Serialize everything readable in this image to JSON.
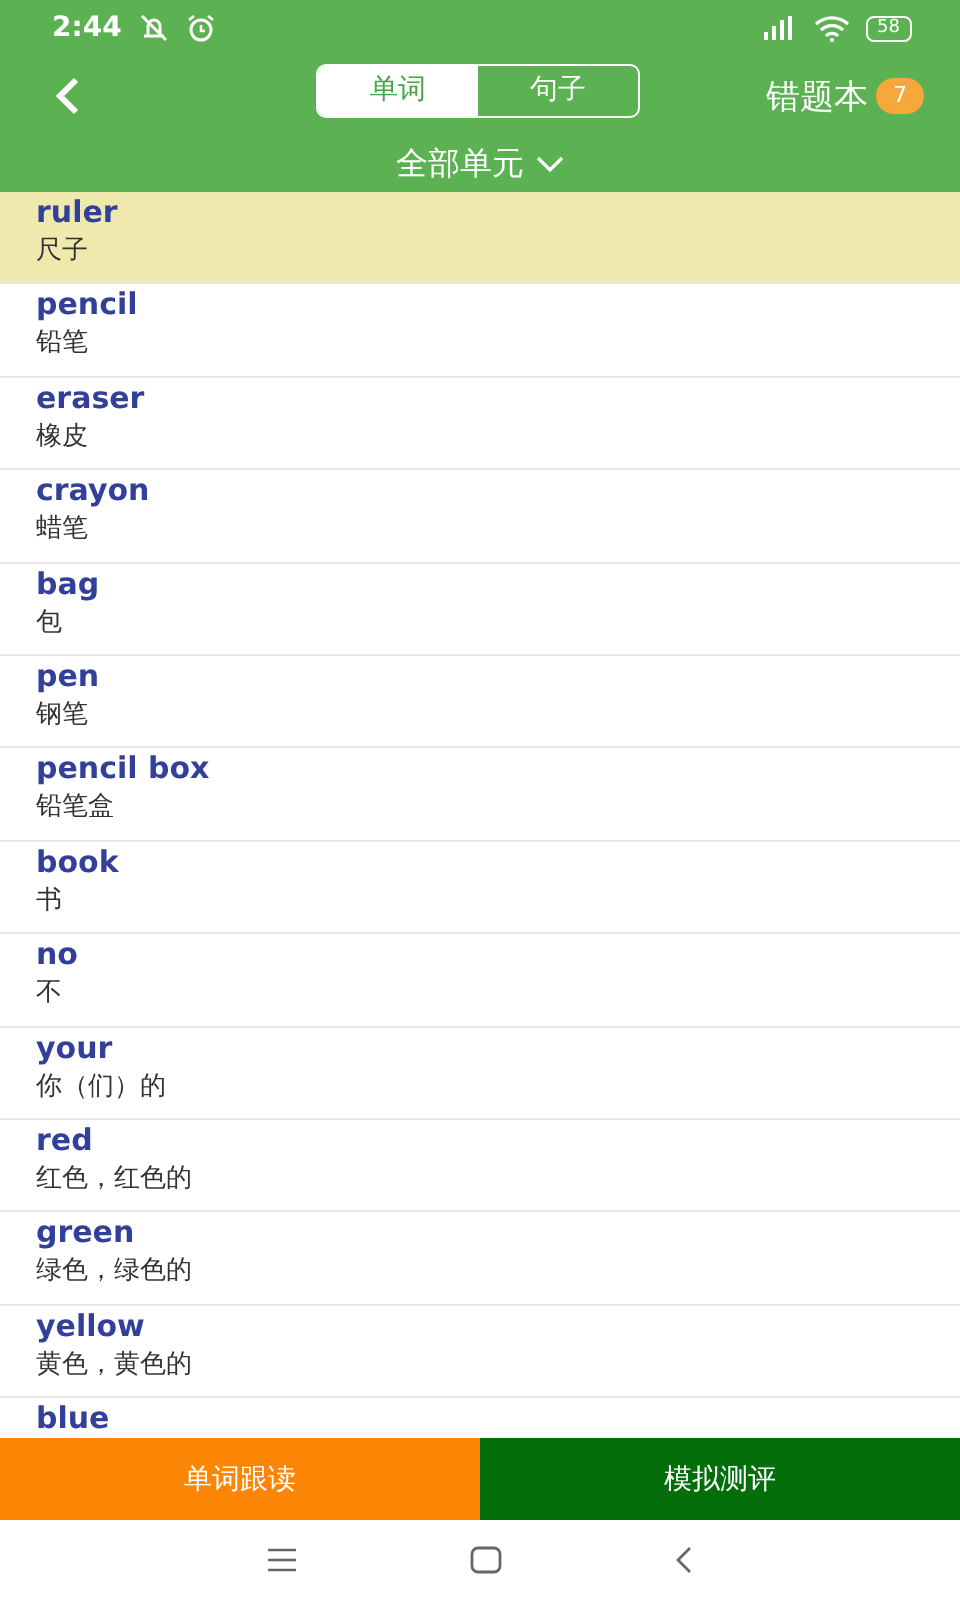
{
  "status_bar": {
    "time": "2:44",
    "battery": "58"
  },
  "header": {
    "tabs": [
      {
        "label": "单词",
        "selected": true
      },
      {
        "label": "句子",
        "selected": false
      }
    ],
    "wrong_book": {
      "label": "错题本",
      "count": "7"
    },
    "unit_filter": "全部单元"
  },
  "words": [
    {
      "word": "ruler",
      "meaning": "尺子",
      "selected": true
    },
    {
      "word": "pencil",
      "meaning": "铅笔",
      "selected": false
    },
    {
      "word": "eraser",
      "meaning": "橡皮",
      "selected": false
    },
    {
      "word": "crayon",
      "meaning": "蜡笔",
      "selected": false
    },
    {
      "word": "bag",
      "meaning": "包",
      "selected": false
    },
    {
      "word": "pen",
      "meaning": "钢笔",
      "selected": false
    },
    {
      "word": "pencil box",
      "meaning": "铅笔盒",
      "selected": false
    },
    {
      "word": "book",
      "meaning": "书",
      "selected": false
    },
    {
      "word": "no",
      "meaning": "不",
      "selected": false
    },
    {
      "word": "your",
      "meaning": "你（们）的",
      "selected": false
    },
    {
      "word": "red",
      "meaning": "红色，红色的",
      "selected": false
    },
    {
      "word": "green",
      "meaning": "绿色，绿色的",
      "selected": false
    },
    {
      "word": "yellow",
      "meaning": "黄色，黄色的",
      "selected": false
    },
    {
      "word": "blue",
      "selected": false
    }
  ],
  "buttons": [
    {
      "label": "单词跟读",
      "kind": "follow"
    },
    {
      "label": "模拟测评",
      "kind": "test"
    }
  ]
}
